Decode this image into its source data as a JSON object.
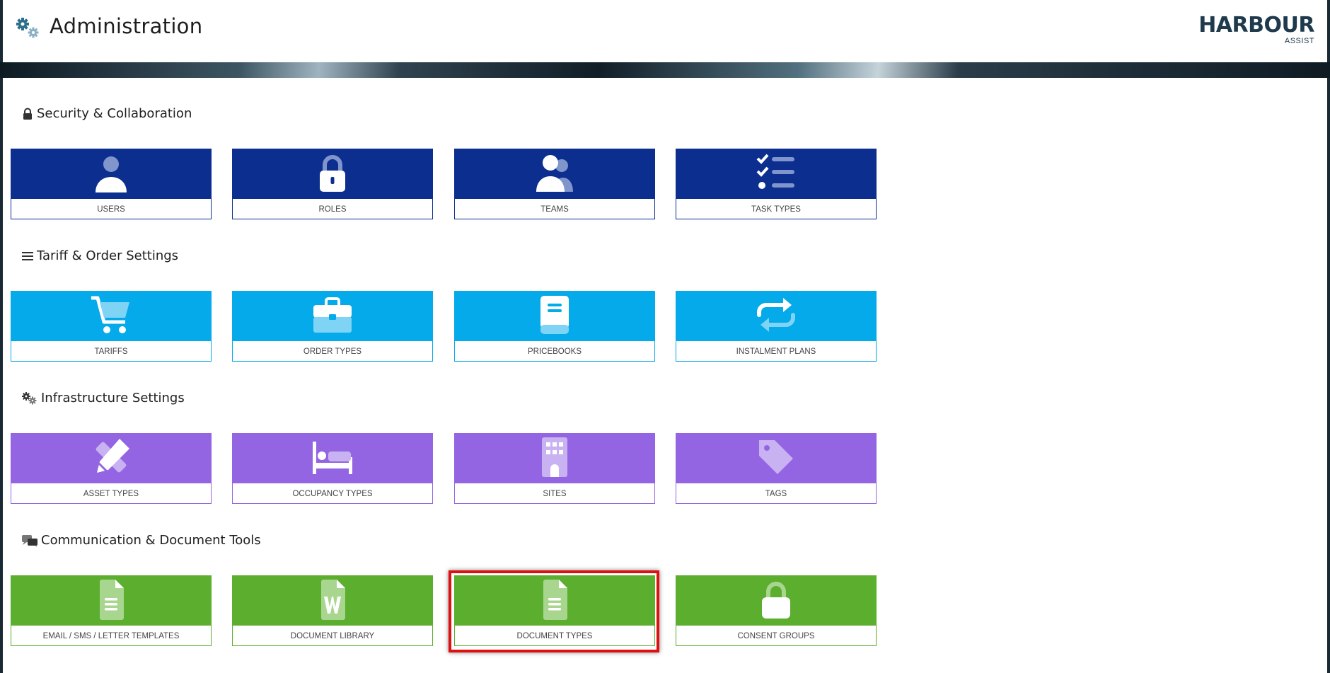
{
  "header": {
    "title": "Administration",
    "logo_text": "HARBOUR",
    "logo_sub": "ASSIST",
    "icon": "gears-icon"
  },
  "colors": {
    "security": "#0b2e8f",
    "tariff": "#04aaea",
    "infrastructure": "#9465e2",
    "communication": "#5bae2e",
    "highlight": "#e01010"
  },
  "sections": [
    {
      "title": "Security & Collaboration",
      "icon": "lock-icon",
      "tiles": [
        {
          "label": "USERS",
          "icon": "user-icon"
        },
        {
          "label": "ROLES",
          "icon": "padlock-icon"
        },
        {
          "label": "TEAMS",
          "icon": "team-icon"
        },
        {
          "label": "TASK TYPES",
          "icon": "checklist-icon"
        }
      ]
    },
    {
      "title": "Tariff & Order Settings",
      "icon": "list-icon",
      "tiles": [
        {
          "label": "TARIFFS",
          "icon": "cart-icon"
        },
        {
          "label": "ORDER TYPES",
          "icon": "briefcase-icon"
        },
        {
          "label": "PRICEBOOKS",
          "icon": "book-icon"
        },
        {
          "label": "INSTALMENT PLANS",
          "icon": "repeat-icon"
        }
      ]
    },
    {
      "title": "Infrastructure Settings",
      "icon": "gears-icon",
      "tiles": [
        {
          "label": "ASSET TYPES",
          "icon": "pencil-ruler-icon"
        },
        {
          "label": "OCCUPANCY TYPES",
          "icon": "bed-icon"
        },
        {
          "label": "SITES",
          "icon": "building-icon"
        },
        {
          "label": "TAGS",
          "icon": "tag-icon"
        }
      ]
    },
    {
      "title": "Communication & Document Tools",
      "icon": "comments-icon",
      "tiles": [
        {
          "label": "EMAIL / SMS / LETTER TEMPLATES",
          "icon": "file-lines-icon"
        },
        {
          "label": "DOCUMENT LIBRARY",
          "icon": "file-word-icon"
        },
        {
          "label": "DOCUMENT TYPES",
          "icon": "file-lines-icon",
          "highlighted": true
        },
        {
          "label": "CONSENT GROUPS",
          "icon": "open-lock-icon"
        }
      ]
    }
  ]
}
